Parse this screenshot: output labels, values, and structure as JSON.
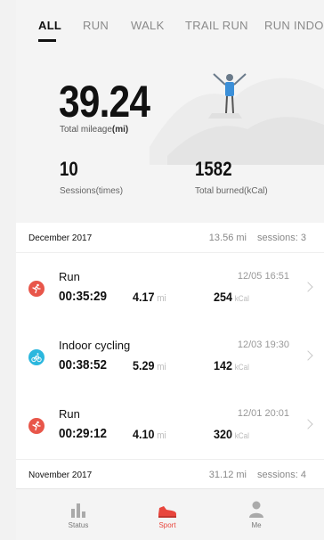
{
  "tabs": [
    "ALL",
    "RUN",
    "WALK",
    "TRAIL RUN",
    "RUN INDOOR"
  ],
  "summary": {
    "mileage": "39.24",
    "mileage_label": "Total mileage",
    "mileage_unit": "(mi)",
    "sessions": "10",
    "sessions_label": "Sessions(times)",
    "burned": "1582",
    "burned_label": "Total burned(kCal)"
  },
  "months": [
    {
      "name": "December 2017",
      "mileage": "13.56 mi",
      "sessions": "sessions: 3",
      "activities": [
        {
          "type": "Run",
          "time": "00:35:29",
          "distance": "4.17",
          "distance_unit": "mi",
          "date": "12/05  16:51",
          "kcal": "254",
          "kcal_unit": "kCal",
          "icon": "run-icon",
          "color": "#e8564a"
        },
        {
          "type": "Indoor cycling",
          "time": "00:38:52",
          "distance": "5.29",
          "distance_unit": "mi",
          "date": "12/03  19:30",
          "kcal": "142",
          "kcal_unit": "kCal",
          "icon": "cycling-icon",
          "color": "#2bb7de"
        },
        {
          "type": "Run",
          "time": "00:29:12",
          "distance": "4.10",
          "distance_unit": "mi",
          "date": "12/01  20:01",
          "kcal": "320",
          "kcal_unit": "kCal",
          "icon": "run-icon",
          "color": "#e8564a"
        }
      ]
    },
    {
      "name": "November 2017",
      "mileage": "31.12 mi",
      "sessions": "sessions: 4"
    }
  ],
  "nav": {
    "status": "Status",
    "sport": "Sport",
    "me": "Me",
    "active_color": "#e8453c"
  }
}
